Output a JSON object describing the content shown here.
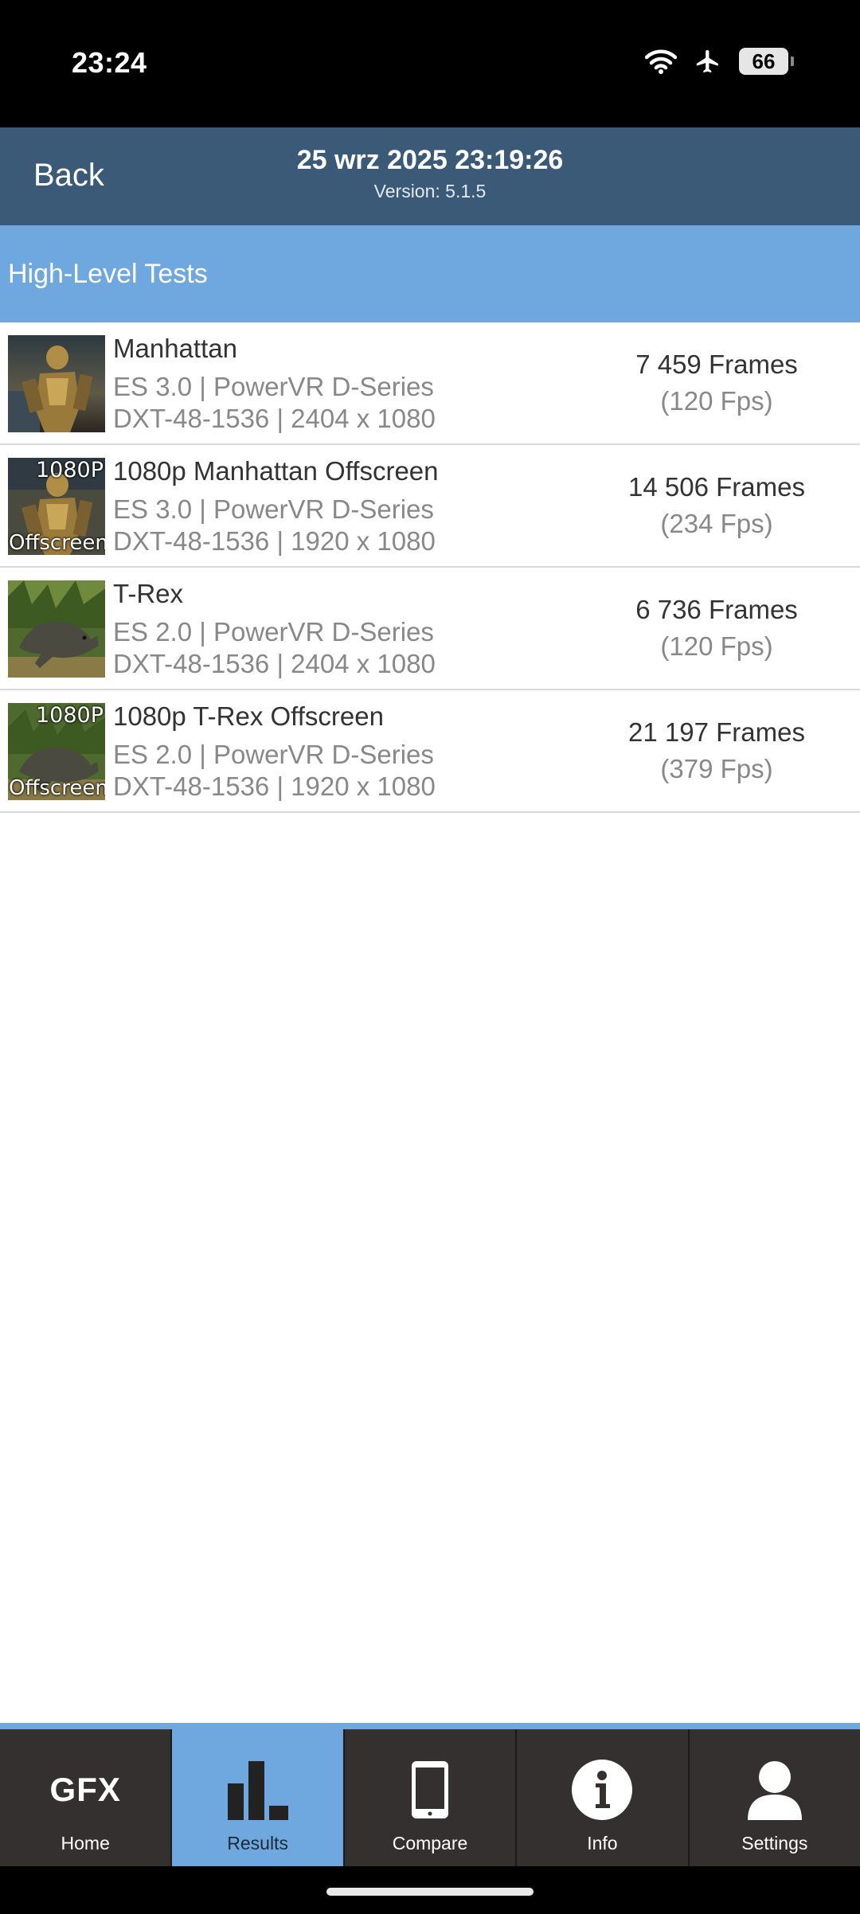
{
  "status_bar": {
    "time": "23:24",
    "battery": "66",
    "icons": [
      "wifi-icon",
      "airplane-icon",
      "battery-icon"
    ]
  },
  "header": {
    "back_label": "Back",
    "title": "25 wrz 2025 23:19:26",
    "version": "Version: 5.1.5"
  },
  "section": {
    "title": "High-Level Tests"
  },
  "tests": [
    {
      "name": "Manhattan",
      "line1": "ES 3.0 | PowerVR D-Series",
      "line2": "DXT-48-1536 | 2404 x 1080",
      "frames": "7 459 Frames",
      "fps": "(120 Fps)",
      "thumb_top": "",
      "thumb_bottom": ""
    },
    {
      "name": "1080p Manhattan Offscreen",
      "line1": "ES 3.0 | PowerVR D-Series",
      "line2": "DXT-48-1536 | 1920 x 1080",
      "frames": "14 506 Frames",
      "fps": "(234 Fps)",
      "thumb_top": "1080P",
      "thumb_bottom": "Offscreen"
    },
    {
      "name": "T-Rex",
      "line1": "ES 2.0 | PowerVR D-Series",
      "line2": "DXT-48-1536 | 2404 x 1080",
      "frames": "6 736 Frames",
      "fps": "(120 Fps)",
      "thumb_top": "",
      "thumb_bottom": ""
    },
    {
      "name": "1080p T-Rex Offscreen",
      "line1": "ES 2.0 | PowerVR D-Series",
      "line2": "DXT-48-1536 | 1920 x 1080",
      "frames": "21 197 Frames",
      "fps": "(379 Fps)",
      "thumb_top": "1080P",
      "thumb_bottom": "Offscreen"
    }
  ],
  "nav": {
    "gfx_logo": "GFX",
    "items": [
      {
        "label": "Home",
        "icon": "gfx-logo-icon"
      },
      {
        "label": "Results",
        "icon": "bar-chart-icon",
        "active": true
      },
      {
        "label": "Compare",
        "icon": "phone-icon"
      },
      {
        "label": "Info",
        "icon": "info-icon"
      },
      {
        "label": "Settings",
        "icon": "user-icon"
      }
    ]
  },
  "colors": {
    "header_bg": "#3b5a78",
    "section_bg": "#6fa8de",
    "nav_bg": "#343030",
    "nav_active": "#6fa8de"
  }
}
